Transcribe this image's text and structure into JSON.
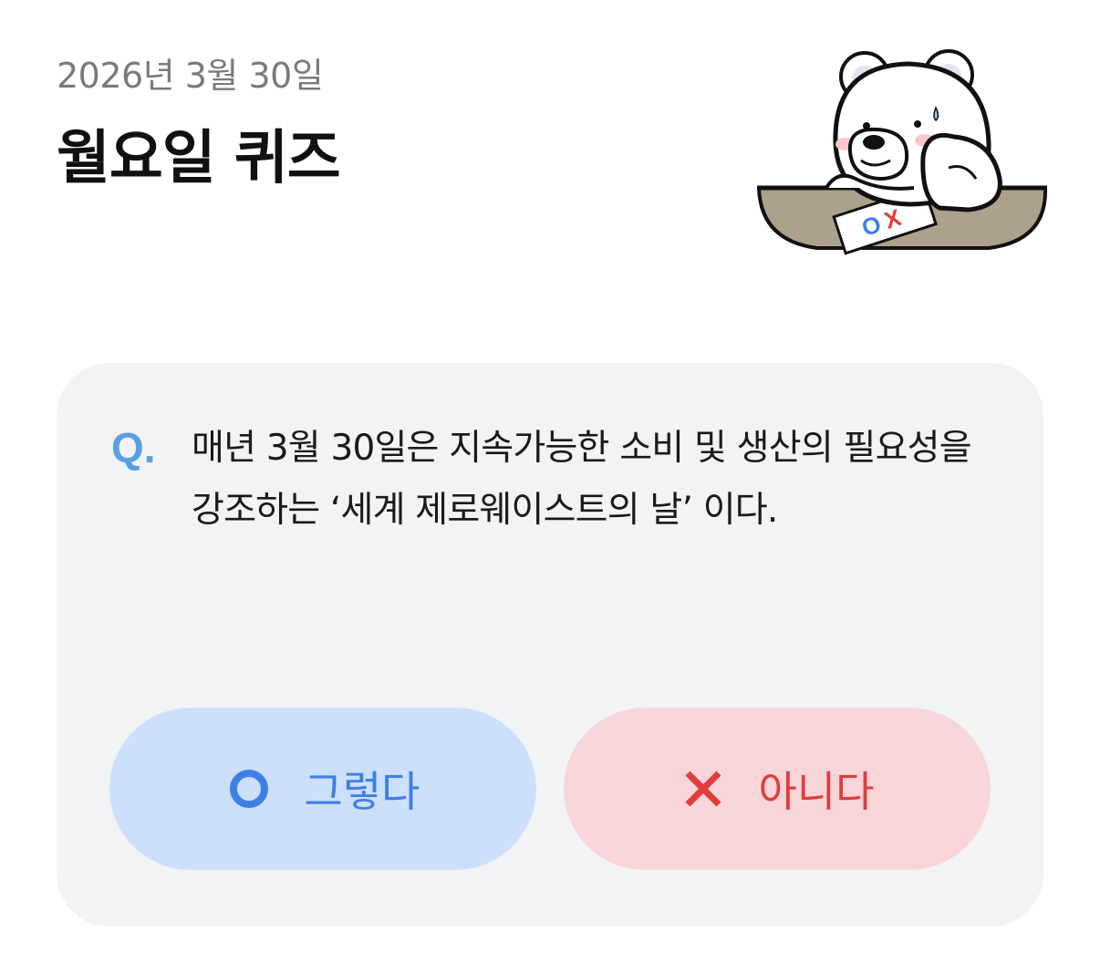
{
  "header": {
    "date": "2026년 3월 30일",
    "title": "월요일 퀴즈"
  },
  "mascot": {
    "icon": "polar-bear-thinking-icon",
    "paper_text": "OX"
  },
  "quiz": {
    "q_label": "Q.",
    "question": "매년 3월 30일은 지속가능한 소비 및 생산의 필요성을 강조하는 ‘세계 제로웨이스트의 날’ 이다.",
    "answers": [
      {
        "label": "그렇다",
        "icon": "circle-o-icon",
        "color": "#3e7fe6",
        "background": "#cde0fb"
      },
      {
        "label": "아니다",
        "icon": "x-mark-icon",
        "color": "#e23c3c",
        "background": "#f8d5d8"
      }
    ]
  },
  "colors": {
    "q_accent": "#5aa0e0",
    "card_background": "#f2f3f5"
  }
}
